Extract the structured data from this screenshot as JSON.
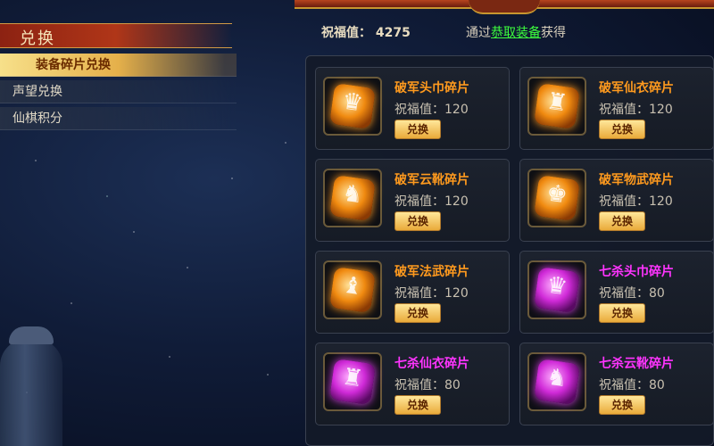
{
  "header": {
    "blessing_label": "祝福值：",
    "blessing_value": "4275",
    "via_prefix": "通过",
    "via_link": "恭取装备",
    "via_suffix": "获得"
  },
  "menu": {
    "title": "兑换",
    "items": [
      {
        "label": "装备碎片兑换",
        "active": true
      },
      {
        "label": "声望兑换",
        "active": false
      },
      {
        "label": "仙棋积分",
        "active": false
      }
    ]
  },
  "cost_label": "祝福值：",
  "items": [
    {
      "name": "破军头巾碎片",
      "cost": "120",
      "button": "兑换",
      "rarity": "orange",
      "icon": "helmet-fragment-icon"
    },
    {
      "name": "破军仙衣碎片",
      "cost": "120",
      "button": "兑换",
      "rarity": "orange",
      "icon": "robe-fragment-icon"
    },
    {
      "name": "破军云靴碎片",
      "cost": "120",
      "button": "兑换",
      "rarity": "orange",
      "icon": "boots-fragment-icon"
    },
    {
      "name": "破军物武碎片",
      "cost": "120",
      "button": "兑换",
      "rarity": "orange",
      "icon": "weapon-fragment-icon"
    },
    {
      "name": "破军法武碎片",
      "cost": "120",
      "button": "兑换",
      "rarity": "orange",
      "icon": "magic-weapon-fragment-icon"
    },
    {
      "name": "七杀头巾碎片",
      "cost": "80",
      "button": "兑换",
      "rarity": "purple",
      "icon": "helmet-fragment-icon"
    },
    {
      "name": "七杀仙衣碎片",
      "cost": "80",
      "button": "兑换",
      "rarity": "purple",
      "icon": "robe-fragment-icon"
    },
    {
      "name": "七杀云靴碎片",
      "cost": "80",
      "button": "兑换",
      "rarity": "purple",
      "icon": "boots-fragment-icon"
    }
  ],
  "colors": {
    "orange_rarity": "#ff9a1e",
    "purple_rarity": "#ff34ff",
    "link_green": "#3dff3d"
  }
}
